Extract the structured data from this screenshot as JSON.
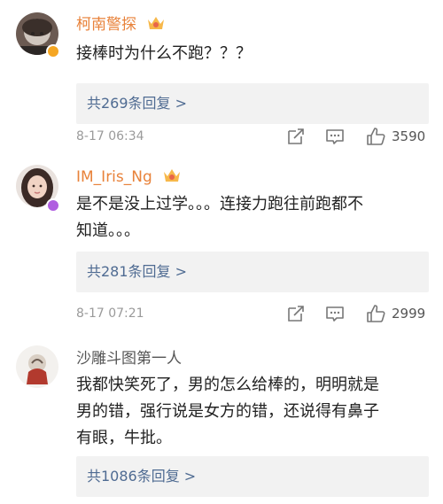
{
  "colors": {
    "username_vip": "#e8823a",
    "username_normal": "#555555",
    "link": "#4f6b92",
    "reply_bg": "#f2f2f2",
    "meta": "#9a9a9a",
    "vbadge_gold": "#f5a623",
    "vbadge_purple": "#b05fe0"
  },
  "icons": {
    "repost": "share-icon",
    "comment": "comment-icon",
    "like": "thumbs-up-icon",
    "crown": "vip-crown-icon",
    "badge": "verified-badge-icon"
  },
  "comments": [
    {
      "username": "柯南警探",
      "text": "接棒时为什么不跑？？？",
      "replies_label": "共269条回复 >",
      "time": "8-17 06:34",
      "likes": "3590"
    },
    {
      "username": "IM_Iris_Ng",
      "text": "是不是没上过学。。。连接力跑往前跑都不\n知道。。。",
      "replies_label": "共281条回复 >",
      "time": "8-17 07:21",
      "likes": "2999"
    },
    {
      "username": "沙雕斗图第一人",
      "text": "我都快笑死了，男的怎么给棒的，明明就是\n男的错，强行说是女方的错，还说得有鼻子\n有眼，牛批。",
      "replies_label": "共1086条回复 >"
    }
  ]
}
